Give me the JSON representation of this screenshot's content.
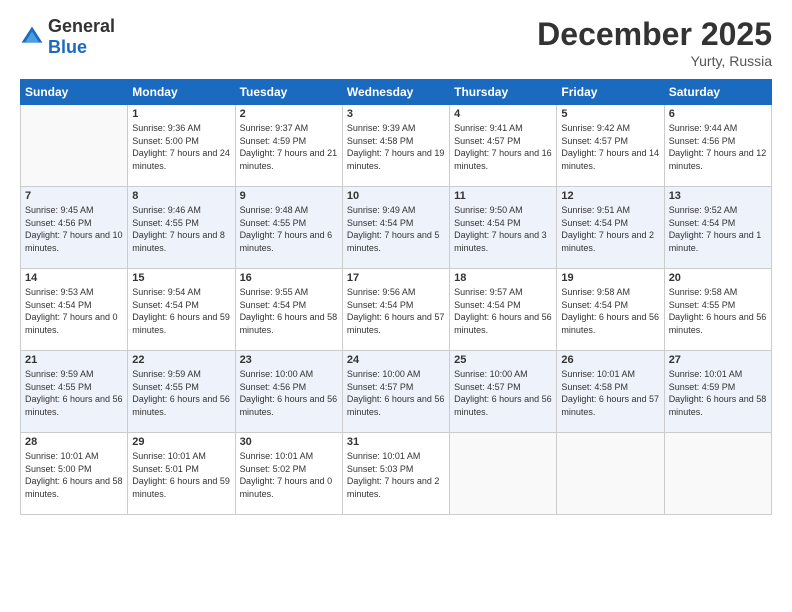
{
  "header": {
    "logo_general": "General",
    "logo_blue": "Blue",
    "month_year": "December 2025",
    "location": "Yurty, Russia"
  },
  "days_of_week": [
    "Sunday",
    "Monday",
    "Tuesday",
    "Wednesday",
    "Thursday",
    "Friday",
    "Saturday"
  ],
  "weeks": [
    [
      {
        "day": "",
        "sunrise": "",
        "sunset": "",
        "daylight": "",
        "empty": true
      },
      {
        "day": "1",
        "sunrise": "Sunrise: 9:36 AM",
        "sunset": "Sunset: 5:00 PM",
        "daylight": "Daylight: 7 hours and 24 minutes."
      },
      {
        "day": "2",
        "sunrise": "Sunrise: 9:37 AM",
        "sunset": "Sunset: 4:59 PM",
        "daylight": "Daylight: 7 hours and 21 minutes."
      },
      {
        "day": "3",
        "sunrise": "Sunrise: 9:39 AM",
        "sunset": "Sunset: 4:58 PM",
        "daylight": "Daylight: 7 hours and 19 minutes."
      },
      {
        "day": "4",
        "sunrise": "Sunrise: 9:41 AM",
        "sunset": "Sunset: 4:57 PM",
        "daylight": "Daylight: 7 hours and 16 minutes."
      },
      {
        "day": "5",
        "sunrise": "Sunrise: 9:42 AM",
        "sunset": "Sunset: 4:57 PM",
        "daylight": "Daylight: 7 hours and 14 minutes."
      },
      {
        "day": "6",
        "sunrise": "Sunrise: 9:44 AM",
        "sunset": "Sunset: 4:56 PM",
        "daylight": "Daylight: 7 hours and 12 minutes."
      }
    ],
    [
      {
        "day": "7",
        "sunrise": "Sunrise: 9:45 AM",
        "sunset": "Sunset: 4:56 PM",
        "daylight": "Daylight: 7 hours and 10 minutes."
      },
      {
        "day": "8",
        "sunrise": "Sunrise: 9:46 AM",
        "sunset": "Sunset: 4:55 PM",
        "daylight": "Daylight: 7 hours and 8 minutes."
      },
      {
        "day": "9",
        "sunrise": "Sunrise: 9:48 AM",
        "sunset": "Sunset: 4:55 PM",
        "daylight": "Daylight: 7 hours and 6 minutes."
      },
      {
        "day": "10",
        "sunrise": "Sunrise: 9:49 AM",
        "sunset": "Sunset: 4:54 PM",
        "daylight": "Daylight: 7 hours and 5 minutes."
      },
      {
        "day": "11",
        "sunrise": "Sunrise: 9:50 AM",
        "sunset": "Sunset: 4:54 PM",
        "daylight": "Daylight: 7 hours and 3 minutes."
      },
      {
        "day": "12",
        "sunrise": "Sunrise: 9:51 AM",
        "sunset": "Sunset: 4:54 PM",
        "daylight": "Daylight: 7 hours and 2 minutes."
      },
      {
        "day": "13",
        "sunrise": "Sunrise: 9:52 AM",
        "sunset": "Sunset: 4:54 PM",
        "daylight": "Daylight: 7 hours and 1 minute."
      }
    ],
    [
      {
        "day": "14",
        "sunrise": "Sunrise: 9:53 AM",
        "sunset": "Sunset: 4:54 PM",
        "daylight": "Daylight: 7 hours and 0 minutes."
      },
      {
        "day": "15",
        "sunrise": "Sunrise: 9:54 AM",
        "sunset": "Sunset: 4:54 PM",
        "daylight": "Daylight: 6 hours and 59 minutes."
      },
      {
        "day": "16",
        "sunrise": "Sunrise: 9:55 AM",
        "sunset": "Sunset: 4:54 PM",
        "daylight": "Daylight: 6 hours and 58 minutes."
      },
      {
        "day": "17",
        "sunrise": "Sunrise: 9:56 AM",
        "sunset": "Sunset: 4:54 PM",
        "daylight": "Daylight: 6 hours and 57 minutes."
      },
      {
        "day": "18",
        "sunrise": "Sunrise: 9:57 AM",
        "sunset": "Sunset: 4:54 PM",
        "daylight": "Daylight: 6 hours and 56 minutes."
      },
      {
        "day": "19",
        "sunrise": "Sunrise: 9:58 AM",
        "sunset": "Sunset: 4:54 PM",
        "daylight": "Daylight: 6 hours and 56 minutes."
      },
      {
        "day": "20",
        "sunrise": "Sunrise: 9:58 AM",
        "sunset": "Sunset: 4:55 PM",
        "daylight": "Daylight: 6 hours and 56 minutes."
      }
    ],
    [
      {
        "day": "21",
        "sunrise": "Sunrise: 9:59 AM",
        "sunset": "Sunset: 4:55 PM",
        "daylight": "Daylight: 6 hours and 56 minutes."
      },
      {
        "day": "22",
        "sunrise": "Sunrise: 9:59 AM",
        "sunset": "Sunset: 4:55 PM",
        "daylight": "Daylight: 6 hours and 56 minutes."
      },
      {
        "day": "23",
        "sunrise": "Sunrise: 10:00 AM",
        "sunset": "Sunset: 4:56 PM",
        "daylight": "Daylight: 6 hours and 56 minutes."
      },
      {
        "day": "24",
        "sunrise": "Sunrise: 10:00 AM",
        "sunset": "Sunset: 4:57 PM",
        "daylight": "Daylight: 6 hours and 56 minutes."
      },
      {
        "day": "25",
        "sunrise": "Sunrise: 10:00 AM",
        "sunset": "Sunset: 4:57 PM",
        "daylight": "Daylight: 6 hours and 56 minutes."
      },
      {
        "day": "26",
        "sunrise": "Sunrise: 10:01 AM",
        "sunset": "Sunset: 4:58 PM",
        "daylight": "Daylight: 6 hours and 57 minutes."
      },
      {
        "day": "27",
        "sunrise": "Sunrise: 10:01 AM",
        "sunset": "Sunset: 4:59 PM",
        "daylight": "Daylight: 6 hours and 58 minutes."
      }
    ],
    [
      {
        "day": "28",
        "sunrise": "Sunrise: 10:01 AM",
        "sunset": "Sunset: 5:00 PM",
        "daylight": "Daylight: 6 hours and 58 minutes."
      },
      {
        "day": "29",
        "sunrise": "Sunrise: 10:01 AM",
        "sunset": "Sunset: 5:01 PM",
        "daylight": "Daylight: 6 hours and 59 minutes."
      },
      {
        "day": "30",
        "sunrise": "Sunrise: 10:01 AM",
        "sunset": "Sunset: 5:02 PM",
        "daylight": "Daylight: 7 hours and 0 minutes."
      },
      {
        "day": "31",
        "sunrise": "Sunrise: 10:01 AM",
        "sunset": "Sunset: 5:03 PM",
        "daylight": "Daylight: 7 hours and 2 minutes."
      },
      {
        "day": "",
        "sunrise": "",
        "sunset": "",
        "daylight": "",
        "empty": true
      },
      {
        "day": "",
        "sunrise": "",
        "sunset": "",
        "daylight": "",
        "empty": true
      },
      {
        "day": "",
        "sunrise": "",
        "sunset": "",
        "daylight": "",
        "empty": true
      }
    ]
  ]
}
